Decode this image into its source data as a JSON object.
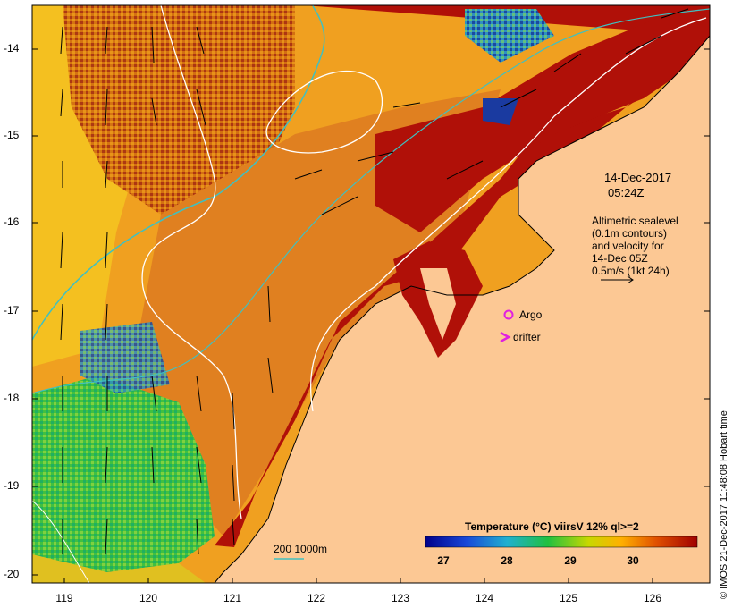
{
  "map": {
    "date_line1": "14-Dec-2017",
    "date_line2": "05:24Z",
    "legend": {
      "line1": "Altimetric sealevel",
      "line2": "(0.1m contours)",
      "line3": "and velocity for",
      "line4": "14-Dec 05Z",
      "line5": "0.5m/s (1kt 24h)"
    },
    "argo_label": "Argo",
    "drifter_label": "drifter",
    "depth_contours_label": "200  1000m",
    "credit": "© IMOS 21-Dec-2017 11:48:08 Hobart time",
    "colorbar": {
      "title": "Temperature (°C) viirsV 12% ql>=2",
      "ticks": [
        "27",
        "28",
        "29",
        "30"
      ]
    },
    "x_ticks": [
      "119",
      "120",
      "121",
      "122",
      "123",
      "124",
      "125",
      "126"
    ],
    "y_ticks": [
      "-14",
      "-15",
      "-16",
      "-17",
      "-18",
      "-19",
      "-20"
    ],
    "colors": {
      "land": "#fcc894",
      "warm": "#b40a00",
      "mid": "#ff9000",
      "yellow": "#f5d000",
      "green": "#22c040",
      "blue": "#1020a0",
      "contour": "#ffffff",
      "bathy": "#40c0c0",
      "argo": "#e020e0"
    }
  }
}
